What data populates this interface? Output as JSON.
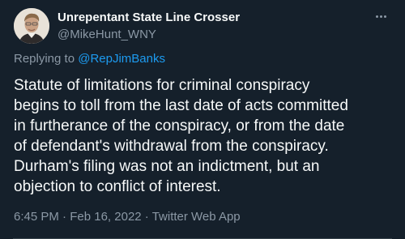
{
  "tweet": {
    "display_name": "Unrepentant State Line Crosser",
    "handle": "@MikeHunt_WNY",
    "reply_prefix": "Replying to ",
    "reply_to": "@RepJimBanks",
    "text": "Statute of limitations for criminal conspiracy\nbegins to toll from the last date of acts committed\nin furtherance of the conspiracy, or from the date\nof defendant's withdrawal from the conspiracy.\nDurham's filing was not an indictment, but an\nobjection to conflict of interest.",
    "time": "6:45 PM",
    "separator": " · ",
    "date": "Feb 16, 2022",
    "source": "Twitter Web App",
    "avatar_icon": "user-avatar-icon",
    "more_icon": "more-options-icon"
  },
  "colors": {
    "background": "#15202b",
    "text": "#f7f9f9",
    "secondary": "#8b98a5",
    "link": "#1d9bf0"
  }
}
